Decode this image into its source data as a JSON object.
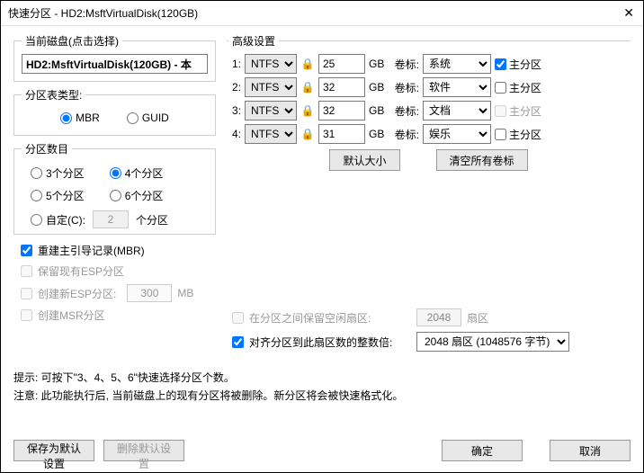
{
  "title": "快速分区 - HD2:MsftVirtualDisk(120GB)",
  "close": "✕",
  "disk": {
    "legend": "当前磁盘(点击选择)",
    "value": "HD2:MsftVirtualDisk(120GB) - 本"
  },
  "tableType": {
    "legend": "分区表类型:",
    "mbr": "MBR",
    "guid": "GUID"
  },
  "count": {
    "legend": "分区数目",
    "p3": "3个分区",
    "p4": "4个分区",
    "p5": "5个分区",
    "p6": "6个分区",
    "custom": "自定(C):",
    "customVal": "2",
    "unit": "个分区"
  },
  "chk": {
    "rebuildMbr": "重建主引导记录(MBR)",
    "keepEsp": "保留现有ESP分区",
    "newEsp": "创建新ESP分区:",
    "espSize": "300",
    "mb": "MB",
    "msr": "创建MSR分区"
  },
  "adv": {
    "legend": "高级设置",
    "rows": [
      {
        "n": "1:",
        "fs": "NTFS",
        "size": "25",
        "vol": "系统",
        "primary": true,
        "primaryEnabled": true
      },
      {
        "n": "2:",
        "fs": "NTFS",
        "size": "32",
        "vol": "软件",
        "primary": false,
        "primaryEnabled": true
      },
      {
        "n": "3:",
        "fs": "NTFS",
        "size": "32",
        "vol": "文档",
        "primary": false,
        "primaryEnabled": false
      },
      {
        "n": "4:",
        "fs": "NTFS",
        "size": "31",
        "vol": "娱乐",
        "primary": false,
        "primaryEnabled": true
      }
    ],
    "gb": "GB",
    "volLabel": "卷标:",
    "primary": "主分区",
    "defaultSize": "默认大小",
    "clearLabels": "清空所有卷标"
  },
  "reserve": {
    "label": "在分区之间保留空闲扇区:",
    "val": "2048",
    "unit": "扇区"
  },
  "align": {
    "label": "对齐分区到此扇区数的整数倍:",
    "val": "2048 扇区 (1048576 字节)"
  },
  "tips": {
    "l1": "提示: 可按下\"3、4、5、6\"快速选择分区个数。",
    "l2": "注意: 此功能执行后, 当前磁盘上的现有分区将被删除。新分区将会被快速格式化。"
  },
  "footer": {
    "saveDefault": "保存为默认设置",
    "deleteDefault": "删除默认设置",
    "ok": "确定",
    "cancel": "取消"
  }
}
